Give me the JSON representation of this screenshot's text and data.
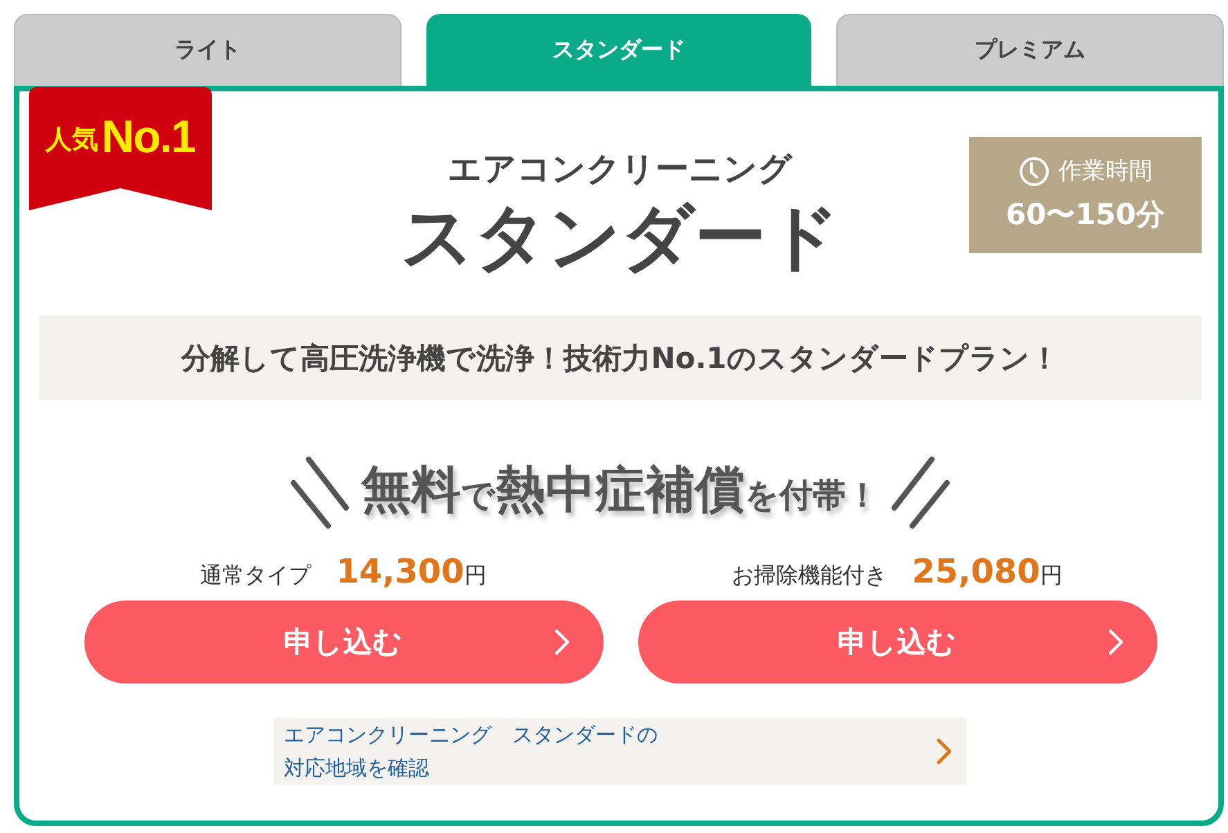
{
  "tabs": [
    {
      "label": "ライト",
      "selected": false
    },
    {
      "label": "スタンダード",
      "selected": true
    },
    {
      "label": "プレミアム",
      "selected": false
    }
  ],
  "badge": {
    "label": "人気",
    "rank": "No.1"
  },
  "plan": {
    "service": "エアコンクリーニング",
    "name": "スタンダード"
  },
  "duration": {
    "label": "作業時間",
    "value": "60〜150分"
  },
  "tagline": "分解して高圧洗浄機で洗浄！技術力No.1のスタンダードプラン！",
  "headline": "**無料**で**熱中症補償**を付帯！",
  "options": [
    {
      "label": "通常タイプ",
      "price": "14,300",
      "unit": "円",
      "button": "申し込む"
    },
    {
      "label": "お掃除機能付き",
      "price": "25,080",
      "unit": "円",
      "button": "申し込む"
    }
  ],
  "area_link": "エアコンクリーニング　スタンダードの対応地域を確認"
}
